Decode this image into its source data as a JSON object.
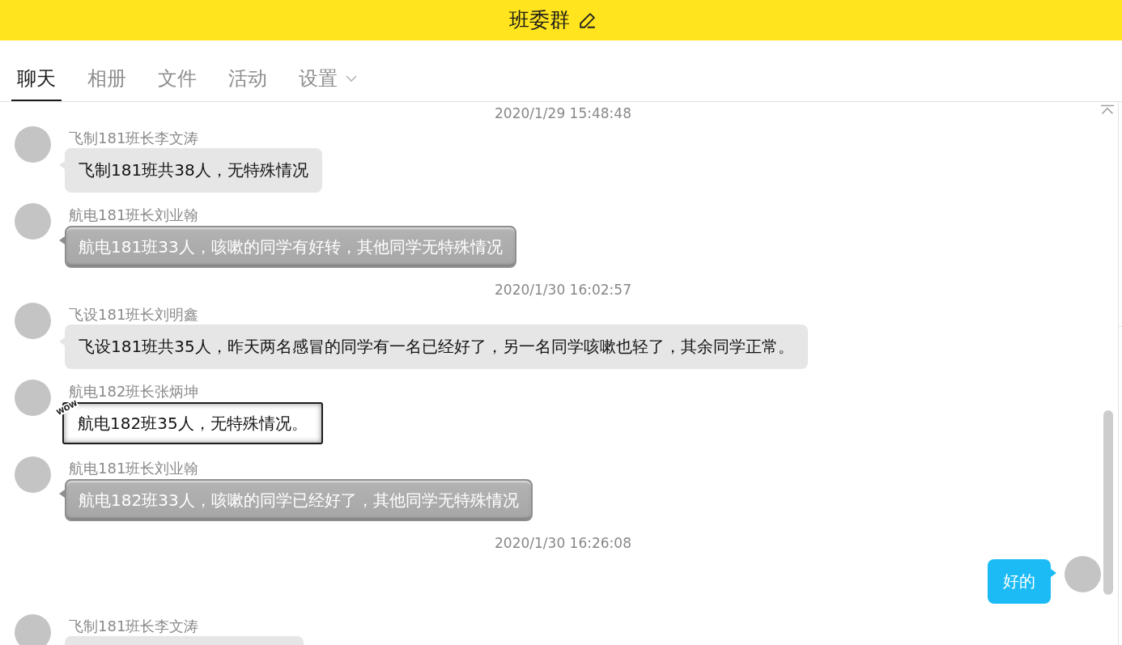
{
  "header": {
    "title": "班委群"
  },
  "tabs": [
    {
      "label": "聊天",
      "selected": true
    },
    {
      "label": "相册",
      "selected": false
    },
    {
      "label": "文件",
      "selected": false
    },
    {
      "label": "活动",
      "selected": false
    },
    {
      "label": "设置",
      "selected": false,
      "has_menu": true
    }
  ],
  "messages": [
    {
      "kind": "time",
      "text": "2020/1/29 15:48:48"
    },
    {
      "kind": "plain",
      "sender": "飞制181班长李文涛",
      "text": "飞制181班共38人，无特殊情况"
    },
    {
      "kind": "glossy",
      "sender": "航电181班长刘业翰",
      "text": "航电181班33人，咳嗽的同学有好转，其他同学无特殊情况"
    },
    {
      "kind": "time",
      "text": "2020/1/30 16:02:57"
    },
    {
      "kind": "plain",
      "sender": "飞设181班长刘明鑫",
      "text": "飞设181班共35人，昨天两名感冒的同学有一名已经好了，另一名同学咳嗽也轻了，其余同学正常。"
    },
    {
      "kind": "comic",
      "sender": "航电182班长张炳坤",
      "sticker": "WOW",
      "text": "航电182班35人，无特殊情况。"
    },
    {
      "kind": "glossy",
      "sender": "航电181班长刘业翰",
      "text": "航电182班33人，咳嗽的同学已经好了，其他同学无特殊情况"
    },
    {
      "kind": "time",
      "text": "2020/1/30 16:26:08"
    },
    {
      "kind": "self",
      "text": "好的"
    },
    {
      "kind": "plain",
      "sender": "飞制181班长李文涛"
    }
  ]
}
